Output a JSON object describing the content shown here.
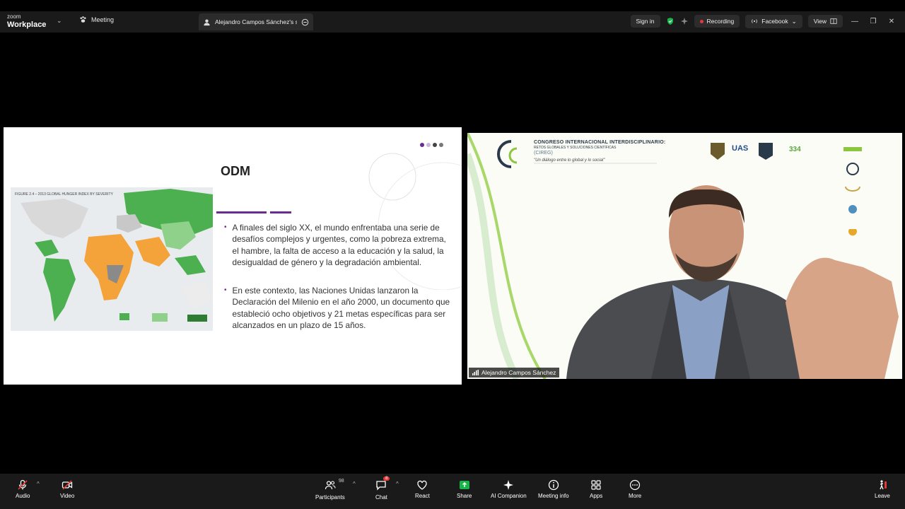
{
  "app": {
    "brand_top": "zoom",
    "brand_bottom": "Workplace"
  },
  "tabs": {
    "meeting": "Meeting",
    "share": "Alejandro Campos Sánchez's scre"
  },
  "header": {
    "sign_in": "Sign in",
    "recording": "Recording",
    "facebook": "Facebook",
    "view": "View"
  },
  "slide": {
    "title": "ODM",
    "map_caption": "FIGURE 2.4 – 2013 GLOBAL HUNGER INDEX BY SEVERITY",
    "bullets": [
      "A finales del siglo XX, el mundo enfrentaba una serie de desafíos complejos y urgentes, como la pobreza extrema, el hambre, la falta de acceso a la educación y la salud, la desigualdad de género y la degradación ambiental.",
      "En este contexto, las Naciones Unidas lanzaron la Declaración del Milenio en el año 2000, un documento que estableció ocho objetivos y 21 metas específicas para ser alcanzados en un plazo de 15 años."
    ]
  },
  "video": {
    "participant_name": "Alejandro Campos Sánchez",
    "congress_line1": "CONGRESO INTERNACIONAL INTERDISCIPLINARIO:",
    "congress_line2": "RETOS GLOBALES Y SOLUCIONES CIENTÍFICAS",
    "congress_line3": "(CIREG)",
    "congress_line4": "\"Un diálogo entre lo global y lo social\"",
    "logo_uas": "UAS",
    "logo_334": "334"
  },
  "toolbar": {
    "audio": "Audio",
    "video": "Video",
    "participants": "Participants",
    "participants_count": "98",
    "chat": "Chat",
    "chat_badge": "8",
    "react": "React",
    "share": "Share",
    "ai_companion": "AI Companion",
    "meeting_info": "Meeting info",
    "apps": "Apps",
    "more": "More",
    "leave": "Leave"
  },
  "colors": {
    "accent_purple": "#6a2c8e",
    "share_green": "#19b34a",
    "record_red": "#e53935"
  }
}
